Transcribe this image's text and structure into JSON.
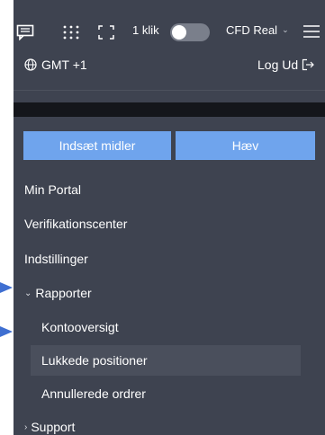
{
  "toolbar": {
    "icons": {
      "chat": "chat-icon",
      "grid": "grid-icon",
      "expand": "expand-icon",
      "menu": "hamburger-menu-icon"
    },
    "one_click_label": "1 klik",
    "one_click_enabled": false,
    "account_label": "CFD Real",
    "timezone_label": "GMT +1",
    "logout_label": "Log Ud"
  },
  "buttons": {
    "deposit_label": "Indsæt midler",
    "withdraw_label": "Hæv"
  },
  "menu": {
    "my_portal": "Min Portal",
    "verification_center": "Verifikationscenter",
    "settings": "Indstillinger",
    "reports": {
      "label": "Rapporter",
      "expanded": true,
      "items": {
        "account_overview": "Kontooversigt",
        "closed_positions": "Lukkede positioner",
        "cancelled_orders": "Annullerede ordrer"
      }
    },
    "support": "Support"
  },
  "colors": {
    "panel_bg": "#3e4350",
    "button_bg": "#6fa4ed",
    "selected_bg": "#4a4f5c",
    "annotation_arrow": "#3f6fd1"
  }
}
